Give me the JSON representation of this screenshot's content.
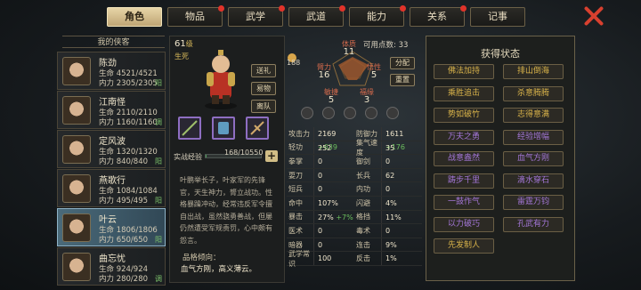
{
  "tabs": [
    {
      "label": "角色",
      "active": true,
      "dot": false
    },
    {
      "label": "物品",
      "active": false,
      "dot": true
    },
    {
      "label": "武学",
      "active": false,
      "dot": true
    },
    {
      "label": "武道",
      "active": false,
      "dot": true
    },
    {
      "label": "能力",
      "active": false,
      "dot": true
    },
    {
      "label": "关系",
      "active": false,
      "dot": true
    },
    {
      "label": "记事",
      "active": false,
      "dot": false
    }
  ],
  "roster_title": "我的侠客",
  "roster": [
    {
      "name": "陈劲",
      "hp": "生命 4521/4521",
      "mp": "内力 2305/2305",
      "tag": "阳"
    },
    {
      "name": "江南怪",
      "hp": "生命 2110/2110",
      "mp": "内力 1160/1160",
      "tag": "调"
    },
    {
      "name": "定风波",
      "hp": "生命 1320/1320",
      "mp": "内力 840/840",
      "tag": "阳"
    },
    {
      "name": "燕歌行",
      "hp": "生命 1084/1084",
      "mp": "内力 495/495",
      "tag": "阳"
    },
    {
      "name": "叶云",
      "hp": "生命 1806/1806",
      "mp": "内力 650/650",
      "tag": "阳"
    },
    {
      "name": "曲忘忧",
      "hp": "生命 924/924",
      "mp": "内力 280/280",
      "tag": "调"
    }
  ],
  "hero": {
    "level": "61",
    "level_unit": "级",
    "life_status": "生死",
    "buttons": [
      "送礼",
      "易物",
      "离队"
    ],
    "exp_label": "实战经验",
    "exp_value": "168/10550",
    "exp_fraction": 0.016,
    "bio": "叶鹏举长子，叶家军的先锋官，天生神力，膂立战功。性格暴躁冲动，经常违反军令擅自出战，虽然骁勇善战，但屡仍然遭受军规责罚，心中颇有怨言。",
    "trait_title": "品格倾向：",
    "trait_value": "血气方刚，高义薄云。"
  },
  "stats_top": {
    "free_points_label": "可用点数:",
    "free_points": "33",
    "allocate": "分配",
    "reset": "重置",
    "p188": "188",
    "attrs": [
      {
        "label": "体质",
        "value": "11"
      },
      {
        "label": "臂力",
        "value": "16"
      },
      {
        "label": "悟性",
        "value": "5"
      },
      {
        "label": "敏捷",
        "value": "5"
      },
      {
        "label": "福缘",
        "value": "3"
      }
    ]
  },
  "stat_grid": [
    [
      [
        "攻击力",
        "2169",
        "+639"
      ],
      [
        "防御力",
        "1611",
        "+176"
      ]
    ],
    [
      [
        "轻功",
        "252",
        ""
      ],
      [
        "集气速度",
        "35",
        ""
      ]
    ],
    [
      [
        "拳掌",
        "0",
        ""
      ],
      [
        "御剑",
        "0",
        ""
      ]
    ],
    [
      [
        "耍刀",
        "0",
        ""
      ],
      [
        "长兵",
        "62",
        ""
      ]
    ],
    [
      [
        "短兵",
        "0",
        ""
      ],
      [
        "内功",
        "0",
        ""
      ]
    ],
    [
      [
        "命中",
        "107%",
        ""
      ],
      [
        "闪避",
        "4%",
        ""
      ]
    ],
    [
      [
        "暴击",
        "27%",
        "+7%"
      ],
      [
        "格挡",
        "11%",
        ""
      ]
    ],
    [
      [
        "医术",
        "0",
        ""
      ],
      [
        "毒术",
        "0",
        ""
      ]
    ],
    [
      [
        "暗器",
        "0",
        ""
      ],
      [
        "连击",
        "9%",
        ""
      ]
    ],
    [
      [
        "武学常识",
        "100",
        ""
      ],
      [
        "反击",
        "1%",
        ""
      ]
    ]
  ],
  "buff_title": "获得状态",
  "buffs": [
    {
      "label": "佛法加持",
      "color": "#d9b34a"
    },
    {
      "label": "排山倒海",
      "color": "#d9b34a"
    },
    {
      "label": "乘胜追击",
      "color": "#d9b34a"
    },
    {
      "label": "杀意腾腾",
      "color": "#d9b34a"
    },
    {
      "label": "势如破竹",
      "color": "#d9b34a"
    },
    {
      "label": "志得意满",
      "color": "#d9b34a"
    },
    {
      "label": "万夫之勇",
      "color": "#a477d8"
    },
    {
      "label": "经验增幅",
      "color": "#a477d8"
    },
    {
      "label": "战意盎然",
      "color": "#a477d8"
    },
    {
      "label": "血气方刚",
      "color": "#a477d8"
    },
    {
      "label": "踌步千里",
      "color": "#a477d8"
    },
    {
      "label": "滴水穿石",
      "color": "#a477d8"
    },
    {
      "label": "一鼓作气",
      "color": "#a477d8"
    },
    {
      "label": "雷霆万钧",
      "color": "#a477d8"
    },
    {
      "label": "以力破巧",
      "color": "#a477d8"
    },
    {
      "label": "孔武有力",
      "color": "#a477d8"
    },
    {
      "label": "先发制人",
      "color": "#d9b34a"
    }
  ]
}
